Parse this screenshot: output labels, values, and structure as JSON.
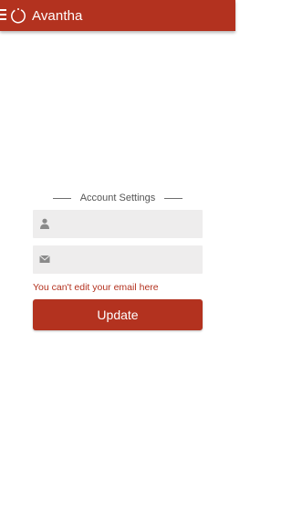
{
  "app_bar": {
    "title": "Avantha",
    "menu_icon": "hamburger-menu-icon",
    "logo_icon": "avantha-logo-icon",
    "background_color": "#b3321f"
  },
  "account_settings": {
    "section_title": "Account Settings",
    "username_field": {
      "icon": "user-icon",
      "value": "",
      "placeholder": ""
    },
    "email_field": {
      "icon": "envelope-icon",
      "value": "",
      "placeholder": ""
    },
    "email_note": "You can't edit your email here",
    "update_button_label": "Update"
  },
  "colors": {
    "accent": "#b3321f",
    "field_background": "#eeeded",
    "error_text": "#b3321f"
  }
}
